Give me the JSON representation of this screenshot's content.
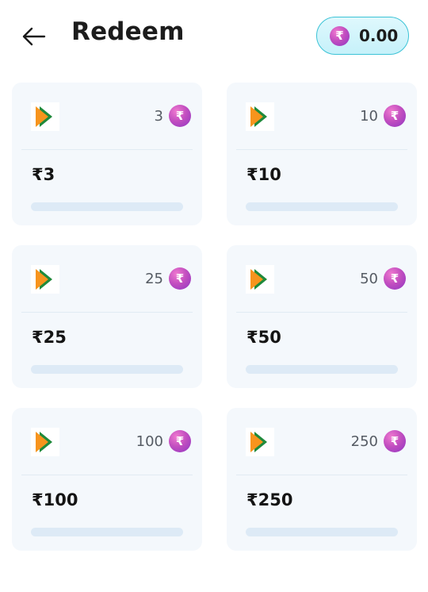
{
  "header": {
    "title": "Redeem",
    "balance": "0.00",
    "currency_symbol": "₹"
  },
  "cards": [
    {
      "cost": "3",
      "value": "₹3",
      "progress": 0
    },
    {
      "cost": "10",
      "value": "₹10",
      "progress": 0
    },
    {
      "cost": "25",
      "value": "₹25",
      "progress": 0
    },
    {
      "cost": "50",
      "value": "₹50",
      "progress": 0
    },
    {
      "cost": "100",
      "value": "₹100",
      "progress": 0
    },
    {
      "cost": "250",
      "value": "₹250",
      "progress": 0
    }
  ],
  "colors": {
    "accent": "#3cc3d6",
    "coin": "#c34fc0",
    "card_bg": "#f4f8fc",
    "logo_orange": "#f7941d",
    "logo_green": "#1f8a3b"
  },
  "icons": {
    "back": "arrow-left-icon",
    "coin": "rupee-coin-icon",
    "logo": "bhim-upi-logo"
  }
}
